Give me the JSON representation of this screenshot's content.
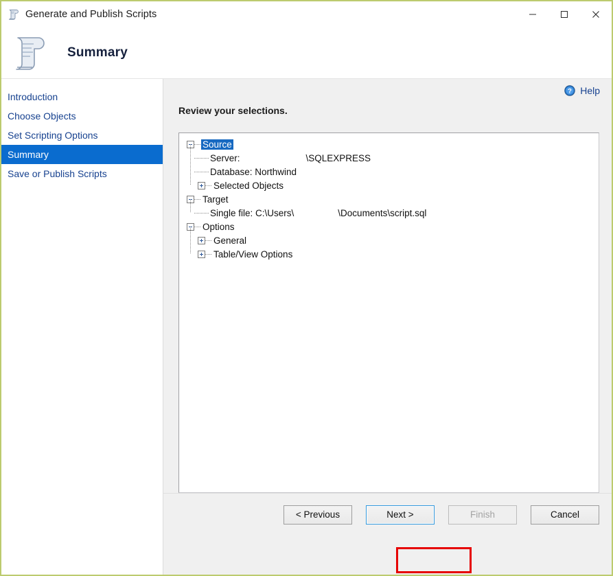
{
  "window": {
    "title": "Generate and Publish Scripts",
    "icon": "script-scroll-icon",
    "controls": {
      "minimize": "minimize-icon",
      "maximize": "maximize-icon",
      "close": "close-icon"
    },
    "border_color": "#bccb6e"
  },
  "header": {
    "title": "Summary",
    "icon": "script-scroll-large-icon"
  },
  "sidebar": {
    "items": [
      {
        "label": "Introduction",
        "selected": false
      },
      {
        "label": "Choose Objects",
        "selected": false
      },
      {
        "label": "Set Scripting Options",
        "selected": false
      },
      {
        "label": "Summary",
        "selected": true
      },
      {
        "label": "Save or Publish Scripts",
        "selected": false
      }
    ],
    "selected_color": "#0a6ccf",
    "link_color": "#16418f"
  },
  "content": {
    "help_label": "Help",
    "help_icon": "help-question-icon",
    "review_label": "Review your selections.",
    "tree": [
      {
        "level": 0,
        "toggle": "minus",
        "label": "Source",
        "selected": true,
        "value": ""
      },
      {
        "level": 1,
        "toggle": "leaf",
        "label": "Server:",
        "selected": false,
        "value": "\\SQLEXPRESS"
      },
      {
        "level": 1,
        "toggle": "leaf",
        "label": "Database: Northwind",
        "selected": false,
        "value": ""
      },
      {
        "level": 1,
        "toggle": "plus",
        "label": "Selected Objects",
        "selected": false,
        "value": ""
      },
      {
        "level": 0,
        "toggle": "minus",
        "label": "Target",
        "selected": false,
        "value": ""
      },
      {
        "level": 1,
        "toggle": "leaf",
        "label": "Single file: C:\\Users\\",
        "selected": false,
        "value": "\\Documents\\script.sql"
      },
      {
        "level": 0,
        "toggle": "minus",
        "label": "Options",
        "selected": false,
        "value": ""
      },
      {
        "level": 1,
        "toggle": "plus",
        "label": "General",
        "selected": false,
        "value": ""
      },
      {
        "level": 1,
        "toggle": "plus",
        "label": "Table/View Options",
        "selected": false,
        "value": ""
      }
    ]
  },
  "footer": {
    "previous_label": "< Previous",
    "next_label": "Next >",
    "finish_label": "Finish",
    "cancel_label": "Cancel",
    "next_highlight_color": "#e60000",
    "finish_disabled": true
  }
}
